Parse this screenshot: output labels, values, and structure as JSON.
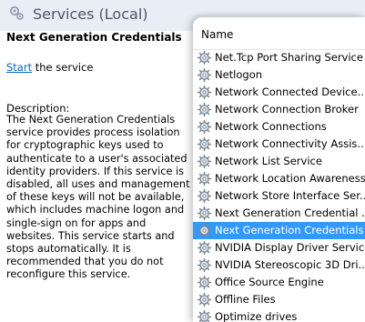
{
  "header": {
    "title": "Services (Local)",
    "icon": "services-gear-icon"
  },
  "details": {
    "service_name": "Next Generation Credentials",
    "action_link": "Start",
    "action_suffix": " the service",
    "description_label": "Description:",
    "description_text": "The Next Generation Credentials service provides process isolation for cryptographic keys used to authenticate to a user's associated identity providers. If this service is disabled, all uses and management of these keys will not be available, which includes machine logon and single-sign on for apps and websites. This service starts and stops automatically. It is recommended that you do not reconfigure this service."
  },
  "list": {
    "column_header": "Name",
    "selected_index": 11,
    "selected_color": "#3399ff",
    "rows": [
      "Net.Tcp Port Sharing Service",
      "Netlogon",
      "Network Connected Device...",
      "Network Connection Broker",
      "Network Connections",
      "Network Connectivity Assis...",
      "Network List Service",
      "Network Location Awareness",
      "Network Store Interface Ser...",
      "Next Generation Credential ...",
      "Next Generation Credentials",
      "NVIDIA Display Driver Service",
      "NVIDIA Stereoscopic 3D Dri...",
      "Office  Source Engine",
      "Offline Files",
      "Optimize drives"
    ]
  }
}
